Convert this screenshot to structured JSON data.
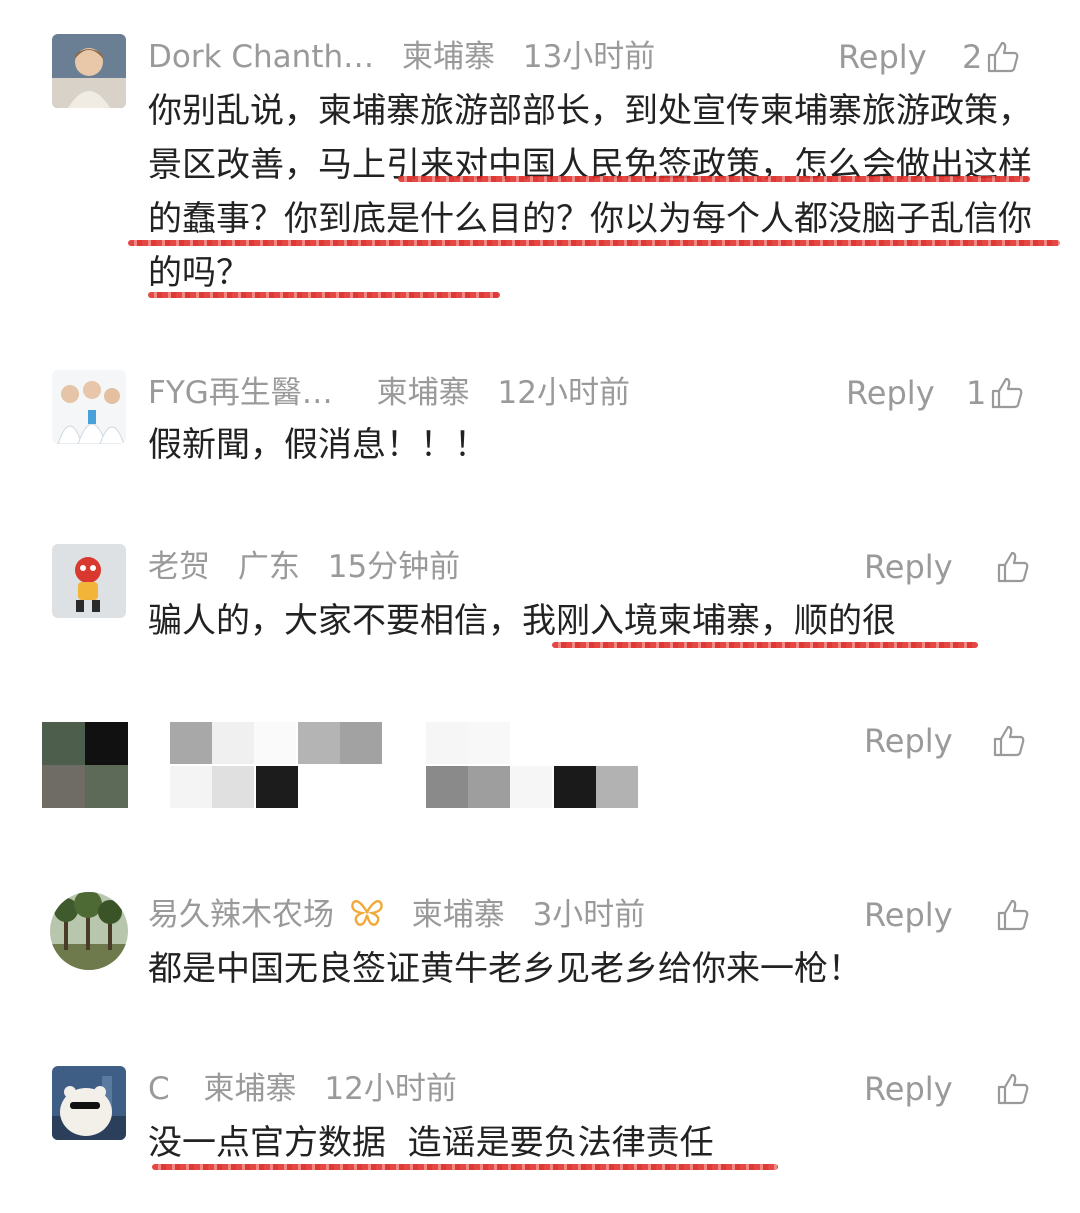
{
  "comments": [
    {
      "name": "Dork Chanth…",
      "location": "柬埔寨",
      "time": "13小时前",
      "reply": "Reply",
      "likes": "2",
      "text": "你别乱说，柬埔寨旅游部部长，到处宣传柬埔寨旅游政策，景区改善，马上引来对中国人民免签政策，怎么会做出这样的蠢事？你到底是什么目的？你以为每个人都没脑子乱信你的吗？"
    },
    {
      "name": "FYG再生醫…",
      "location": "柬埔寨",
      "time": "12小时前",
      "reply": "Reply",
      "likes": "1",
      "text": "假新聞，假消息！！！"
    },
    {
      "name": "老贺",
      "location": "广东",
      "time": "15分钟前",
      "reply": "Reply",
      "likes": "",
      "text": "骗人的，大家不要相信，我刚入境柬埔寨，顺的很"
    },
    {
      "reply": "Reply"
    },
    {
      "name": "易久辣木农场",
      "location": "柬埔寨",
      "time": "3小时前",
      "reply": "Reply",
      "likes": "",
      "text": "都是中国无良签证黄牛老乡见老乡给你来一枪！"
    },
    {
      "name": "C",
      "location": "柬埔寨",
      "time": "12小时前",
      "reply": "Reply",
      "likes": "",
      "text": "没一点官方数据  造谣是要负法律责任"
    }
  ],
  "colors": {
    "meta": "#9a9a9a",
    "text": "#222222",
    "underline": "#e0342f",
    "badge": "#f2a93b"
  },
  "icons": {
    "like": "thumbs-up-icon",
    "badge": "butterfly-icon"
  }
}
